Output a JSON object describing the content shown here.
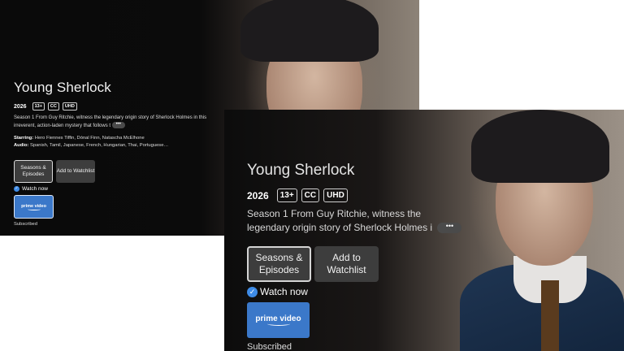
{
  "small": {
    "title": "Young Sherlock",
    "year": "2026",
    "badges": [
      "13+",
      "CC",
      "UHD"
    ],
    "description": "Season 1  From Guy Ritchie, witness the legendary origin story of Sherlock Holmes in this irreverent, action-laden mystery that follows t",
    "more_label": "•••",
    "starring_label": "Starring:",
    "starring": "Hero Fiennes Tiffin, Dónal Finn, Natascha McElhone",
    "audio_label": "Audio:",
    "audio": "Spanish, Tamil, Japanese, French, Hungarian, Thai, Portuguese…",
    "seasons_button": "Seasons & Episodes",
    "watchlist_button": "Add to Watchlist",
    "watch_now": "Watch now",
    "check_glyph": "✓",
    "provider_logo": "prime video",
    "subscribed": "Subscribed"
  },
  "large": {
    "title": "Young Sherlock",
    "year": "2026",
    "badges": [
      "13+",
      "CC",
      "UHD"
    ],
    "description": "Season 1  From Guy Ritchie, witness the legendary origin story of Sherlock Holmes i",
    "more_label": "•••",
    "seasons_button": "Seasons & Episodes",
    "watchlist_button": "Add to Watchlist",
    "watch_now": "Watch now",
    "check_glyph": "✓",
    "provider_logo": "prime video",
    "subscribed": "Subscribed"
  },
  "colors": {
    "accent_blue": "#3e8be6",
    "provider_blue": "#3b78c9",
    "button_grey": "#3d3d3d"
  }
}
